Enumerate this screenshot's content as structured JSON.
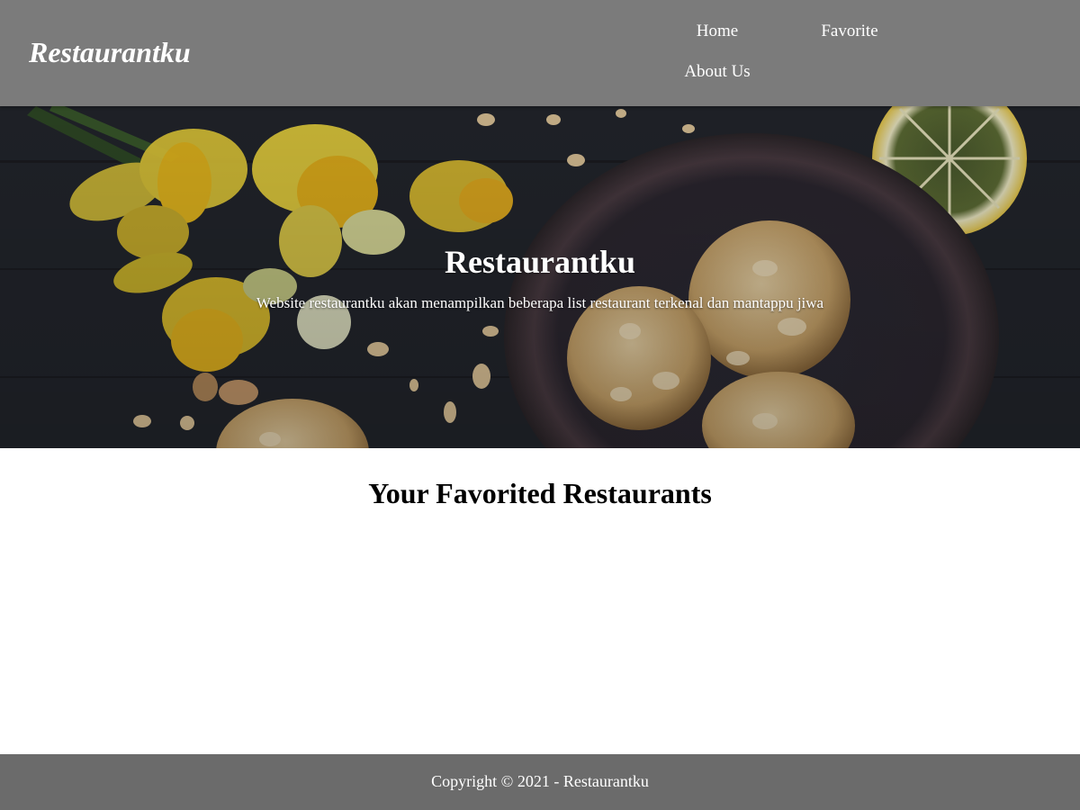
{
  "header": {
    "brand": "Restaurantku",
    "nav": {
      "home": "Home",
      "favorite": "Favorite",
      "about": "About Us"
    }
  },
  "hero": {
    "title": "Restaurantku",
    "subtitle": "Website restaurantku akan menampilkan beberapa list restaurant terkenal dan mantappu jiwa"
  },
  "main": {
    "title": "Your Favorited Restaurants",
    "restaurants": []
  },
  "footer": {
    "copyright": "Copyright © 2021 - Restaurantku"
  },
  "colors": {
    "header_bg": "#7b7b7b",
    "footer_bg": "#6b6b6b",
    "text_light": "#ffffff"
  }
}
